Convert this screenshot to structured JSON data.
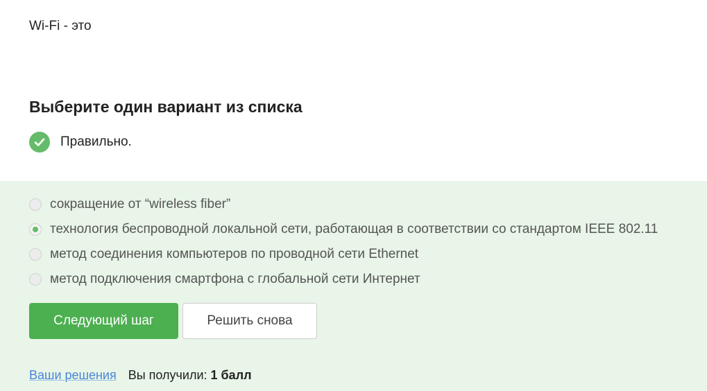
{
  "question": {
    "text": "Wi-Fi - это"
  },
  "instruction": "Выберите один вариант из списка",
  "feedback": {
    "text": "Правильно.",
    "icon": "checkmark-circle-icon",
    "color": "#66bb6a"
  },
  "options": [
    {
      "label": "сокращение от “wireless fiber”",
      "selected": false
    },
    {
      "label": "технология беспроводной локальной сети, работающая в соответствии со стандартом IEEE 802.11",
      "selected": true
    },
    {
      "label": "метод соединения компьютеров по проводной сети Ethernet",
      "selected": false
    },
    {
      "label": "метод подключения смартфона с глобальной сети Интернет",
      "selected": false
    }
  ],
  "buttons": {
    "next_label": "Следующий шаг",
    "retry_label": "Решить снова"
  },
  "footer": {
    "solutions_link": "Ваши решения",
    "score_label": "Вы получили:",
    "score_value": "1 балл"
  },
  "colors": {
    "accent": "#4caf50",
    "panel_background": "#e8f5e8",
    "link": "#4a86d6"
  }
}
